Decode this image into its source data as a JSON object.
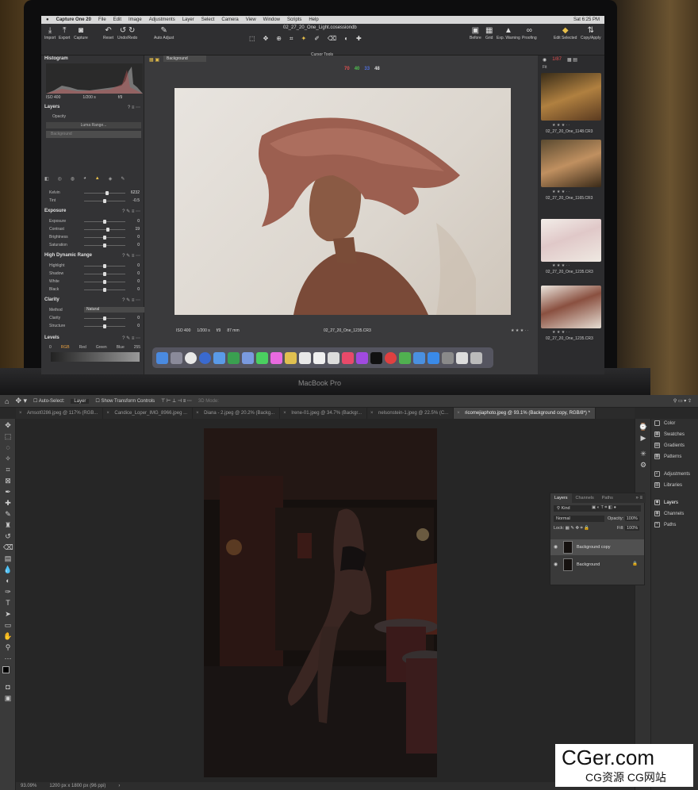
{
  "macos": {
    "apple_icon": "apple-logo-icon",
    "app_name": "Capture One 20",
    "menus": [
      "File",
      "Edit",
      "Image",
      "Adjustments",
      "Layer",
      "Select",
      "Camera",
      "View",
      "Window",
      "Scripts",
      "Help"
    ],
    "clock": "Sat 6:25 PM"
  },
  "capture_one": {
    "session_file": "02_27_20_One_Light.cosessiondb",
    "toolbar": {
      "import": "Import",
      "export": "Export",
      "capture": "Capture",
      "reset": "Reset",
      "undo_redo": "Undo/Redo",
      "auto_adjust": "Auto Adjust",
      "cursor_tools": "Cursor Tools",
      "before": "Before",
      "grid": "Grid",
      "exp_warning": "Exp. Warning",
      "proofing": "Proofing",
      "edit_selected": "Edit Selected",
      "copy_apply": "Copy/Apply"
    },
    "layer_select": "Background",
    "rgb_readout": {
      "r": "70",
      "g": "40",
      "b": "33",
      "l": "48"
    },
    "count": "1/87",
    "fit": "Fit",
    "histogram": {
      "title": "Histogram",
      "iso": "ISO 400",
      "shutter": "1/200 s",
      "aperture": "f/9"
    },
    "layers": {
      "title": "Layers",
      "opacity_label": "Opacity",
      "luma_range": "Luma Range...",
      "background": "Background"
    },
    "white_balance": [
      {
        "label": "Kelvin",
        "value": "6232",
        "pos": 0.55
      },
      {
        "label": "Tint",
        "value": "-0.5",
        "pos": 0.5
      }
    ],
    "exposure": {
      "title": "Exposure",
      "rows": [
        {
          "label": "Exposure",
          "value": "0",
          "pos": 0.5
        },
        {
          "label": "Contrast",
          "value": "19",
          "pos": 0.58
        },
        {
          "label": "Brightness",
          "value": "0",
          "pos": 0.5
        },
        {
          "label": "Saturation",
          "value": "0",
          "pos": 0.5
        }
      ]
    },
    "hdr": {
      "title": "High Dynamic Range",
      "rows": [
        {
          "label": "Highlight",
          "value": "0",
          "pos": 0.5
        },
        {
          "label": "Shadow",
          "value": "0",
          "pos": 0.5
        },
        {
          "label": "White",
          "value": "0",
          "pos": 0.5
        },
        {
          "label": "Black",
          "value": "0",
          "pos": 0.5
        }
      ]
    },
    "clarity": {
      "title": "Clarity",
      "method_label": "Method",
      "method_value": "Natural",
      "rows": [
        {
          "label": "Clarity",
          "value": "0",
          "pos": 0.5
        },
        {
          "label": "Structure",
          "value": "0",
          "pos": 0.5
        }
      ]
    },
    "levels": {
      "title": "Levels",
      "channels": [
        "RGB",
        "Red",
        "Green",
        "Blue"
      ],
      "low": "0",
      "high": "255"
    },
    "viewer": {
      "iso": "ISO 400",
      "shutter": "1/200 s",
      "aperture": "f/9",
      "focal": "87 mm",
      "filename": "02_27_20_One_1235.CR3"
    },
    "thumbs": [
      {
        "name": "02_27_20_One_1148.CR3",
        "stars": "★ ★ ★ · ·"
      },
      {
        "name": "02_27_20_One_1165.CR3",
        "stars": "★ ★ ★ · ·"
      },
      {
        "name": "02_27_20_One_1235.CR3",
        "stars": "★ ★ ★ · ·"
      },
      {
        "name": "02_27_20_One_1235.CR3",
        "stars": "★ ★ ★ · ·"
      }
    ]
  },
  "macbook_label": "MacBook Pro",
  "photoshop": {
    "options": {
      "auto_select": "Auto-Select:",
      "layer_select": "Layer",
      "transform": "Show Transform Controls",
      "mode_3d": "3D Mode:"
    },
    "tabs": [
      {
        "label": "Amsot0286.jpeg @ 117% (RGB...",
        "active": false
      },
      {
        "label": "Candice_Loper_IMG_8966.jpeg ...",
        "active": false
      },
      {
        "label": "Diana - 2.jpeg @ 20.2% (Backg...",
        "active": false
      },
      {
        "label": "Irene-01.jpeg @ 34.7% (Backgr...",
        "active": false
      },
      {
        "label": "nelsonstein-1.jpeg @ 22.5% (C...",
        "active": false
      },
      {
        "label": "ricomejiaphoto.jpeg @ 93.1% (Background copy, RGB/8*) *",
        "active": true
      }
    ],
    "right_panels": [
      "Color",
      "Swatches",
      "Gradients",
      "Patterns",
      "Adjustments",
      "Libraries",
      "Layers",
      "Channels",
      "Paths"
    ],
    "layers_panel": {
      "tabs": [
        "Layers",
        "Channels",
        "Paths"
      ],
      "kind": "Kind",
      "blend": "Normal",
      "opacity_label": "Opacity:",
      "opacity_value": "100%",
      "lock_label": "Lock:",
      "fill_label": "Fill:",
      "fill_value": "100%",
      "layers": [
        {
          "name": "Background copy",
          "selected": true
        },
        {
          "name": "Background",
          "selected": false
        }
      ]
    },
    "status": {
      "zoom": "93.09%",
      "doc": "1200 px x 1800 px (96 ppi)"
    }
  },
  "watermark": {
    "main": "CGer.com",
    "sub": "CG资源 CG网站"
  }
}
